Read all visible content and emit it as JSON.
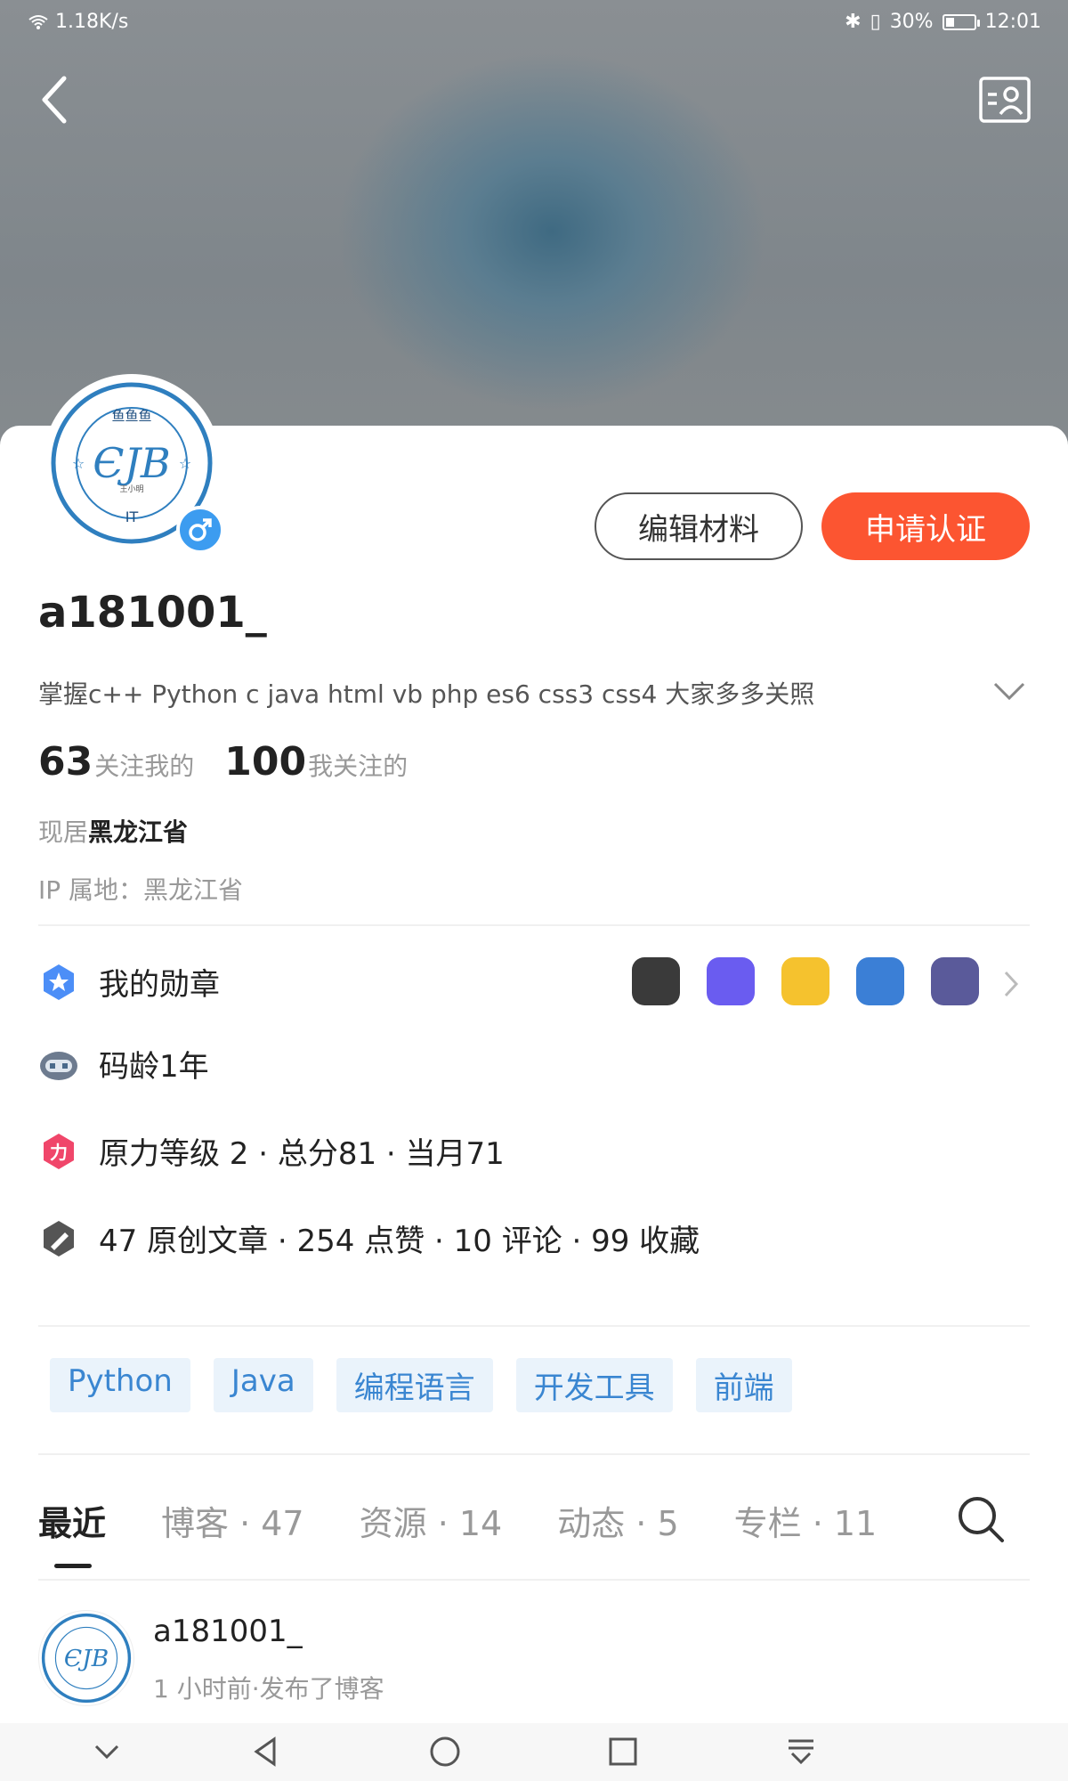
{
  "status_bar": {
    "speed": "1.18K/s",
    "battery_pct": "30%",
    "battery_level": 0.3,
    "time": "12:01",
    "icons": [
      "wifi-icon",
      "bluetooth-icon",
      "vibrate-icon",
      "battery-icon"
    ]
  },
  "header": {
    "back_icon": "back-arrow-icon",
    "card_icon": "contact-card-icon"
  },
  "profile": {
    "avatar_text_top": "鱼鱼鱼",
    "avatar_text_bottom": "IT",
    "avatar_initials": "ЄЈВ",
    "avatar_small": "王小明",
    "username": "a181001_",
    "bio": "掌握c++ Python c java html vb php es6 css3 css4 大家多多关照",
    "followers_count": "63",
    "followers_label": "关注我的",
    "following_count": "100",
    "following_label": "我关注的",
    "location_prefix": "现居",
    "location": "黑龙江省",
    "ip_location": "IP 属地：黑龙江省"
  },
  "actions": {
    "edit_label": "编辑材料",
    "verify_label": "申请认证"
  },
  "info": {
    "medals_label": "我的勋章",
    "coding_age": "码龄1年",
    "level_text": "原力等级 2 · 总分81 · 当月71",
    "content_stats": "47 原创文章 · 254 点赞 · 10 评论 · 99 收藏"
  },
  "badges": [
    {
      "name": "badge-1",
      "color": "#3a3a3a"
    },
    {
      "name": "badge-2",
      "color": "#6a5cf0"
    },
    {
      "name": "badge-3",
      "color": "#f5c22e"
    },
    {
      "name": "badge-4",
      "color": "#3b7fd6"
    },
    {
      "name": "badge-5",
      "color": "#5a5a9a"
    }
  ],
  "tags": [
    "Python",
    "Java",
    "编程语言",
    "开发工具",
    "前端"
  ],
  "tabs": [
    "最近",
    "博客 · 47",
    "资源 · 14",
    "动态 · 5",
    "专栏 · 11"
  ],
  "feed": {
    "name": "a181001_",
    "meta": "1 小时前·发布了博客"
  },
  "colors": {
    "accent": "#fc5531",
    "tag_bg": "#eaf3fb",
    "tag_text": "#3a86d1",
    "gender": "#3c9cf0"
  }
}
